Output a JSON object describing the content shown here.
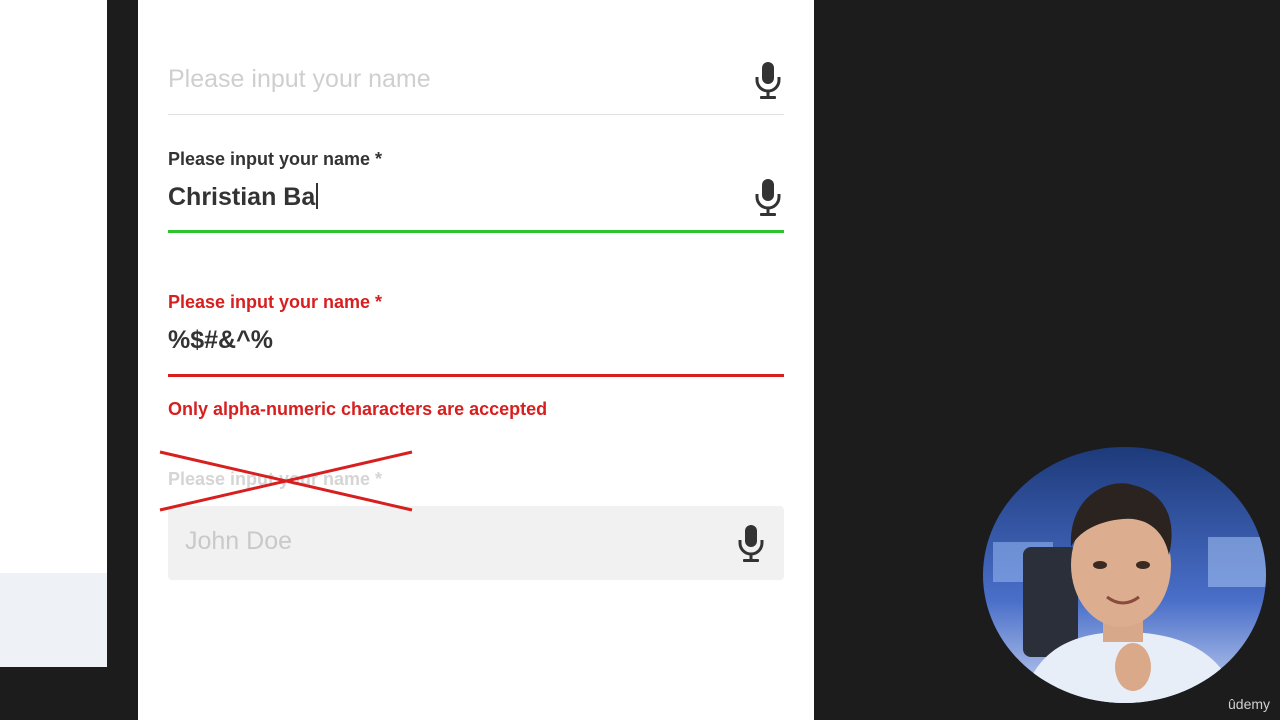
{
  "fields": [
    {
      "placeholder": "Please input your name",
      "icon": "microphone-icon"
    },
    {
      "label": "Please input your name *",
      "value": "Christian Ba",
      "state": "focused",
      "accent": "#2ec42e",
      "icon": "microphone-icon"
    },
    {
      "label": "Please input your name *",
      "value": "%$#&^%",
      "state": "error",
      "accent": "#d81f1f",
      "error": "Only alpha-numeric characters are accepted"
    },
    {
      "label": "Please input your name *",
      "placeholder": "John Doe",
      "state": "disabled",
      "crossed_out": true,
      "icon": "microphone-icon"
    }
  ],
  "colors": {
    "success": "#2ec42e",
    "error": "#d81f1f",
    "text": "#333333",
    "background": "#1c1c1c"
  },
  "watermark": "ûdemy"
}
